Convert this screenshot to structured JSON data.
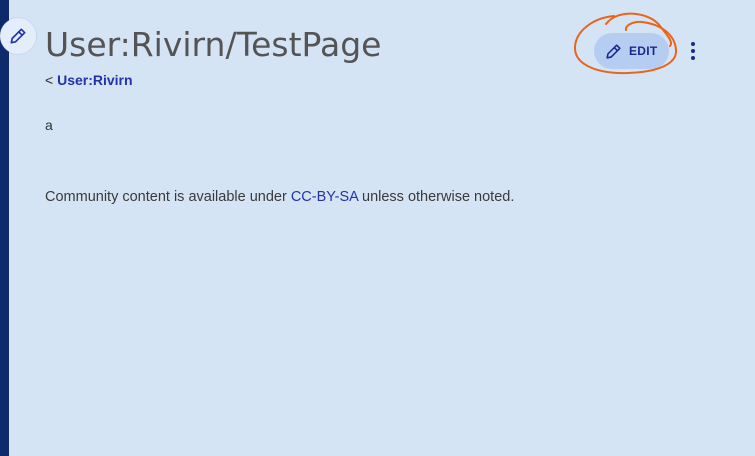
{
  "page": {
    "title": "User:Rivirn/TestPage",
    "parent_prefix": "< ",
    "parent_link": "User:Rivirn",
    "content": "a"
  },
  "toolbar": {
    "edit_label": "EDIT"
  },
  "footer": {
    "license_prefix": "Community content is available under ",
    "license_link": "CC-BY-SA",
    "license_suffix": " unless otherwise noted."
  },
  "icons": {
    "floating_edit": "pencil-icon",
    "edit": "pencil-icon",
    "more": "more-vertical-icon"
  },
  "colors": {
    "background": "#d4e4f5",
    "rail": "#0f2a6a",
    "link": "#2233aa",
    "edit_button_bg": "#b6cdf2",
    "annotation": "#e8651a"
  }
}
